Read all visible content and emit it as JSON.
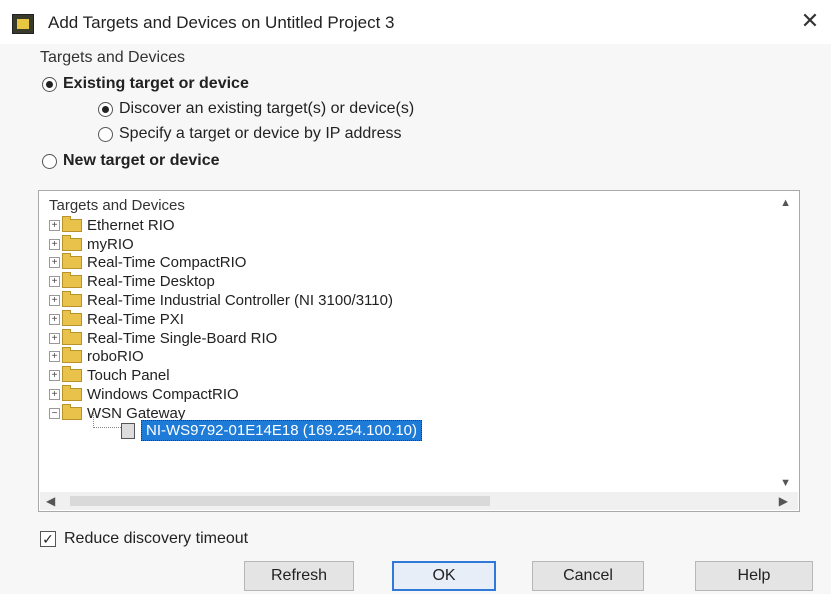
{
  "window": {
    "title": "Add Targets and Devices on Untitled Project 3",
    "close_glyph": "✕"
  },
  "group_label": "Targets and Devices",
  "options": {
    "existing": "Existing target or device",
    "discover": "Discover an existing target(s) or device(s)",
    "specify_ip": "Specify a target or device by IP address",
    "new": "New target or device"
  },
  "tree": {
    "header": "Targets and Devices",
    "items": [
      "Ethernet RIO",
      "myRIO",
      "Real-Time CompactRIO",
      "Real-Time Desktop",
      "Real-Time Industrial Controller (NI 3100/3110)",
      "Real-Time PXI",
      "Real-Time Single-Board RIO",
      "roboRIO",
      "Touch Panel",
      "Windows CompactRIO",
      "WSN Gateway"
    ],
    "selected_child": "NI-WS9792-01E14E18 (169.254.100.10)"
  },
  "reduce_timeout_label": "Reduce discovery timeout",
  "buttons": {
    "refresh": "Refresh",
    "ok": "OK",
    "cancel": "Cancel",
    "help": "Help"
  },
  "icons": {
    "app": "labview-icon",
    "folder": "folder-icon",
    "device": "device-icon",
    "expand": "plus-expander-icon",
    "collapse": "minus-expander-icon"
  }
}
